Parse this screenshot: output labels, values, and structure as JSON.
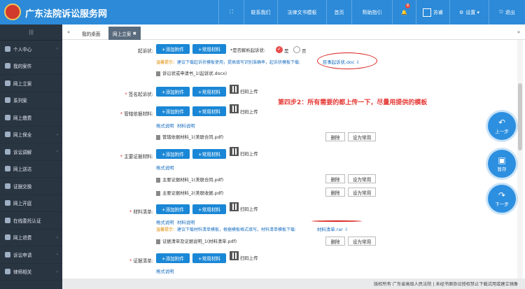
{
  "header": {
    "brand": "广东法院诉讼服务网",
    "nav": [
      {
        "icon": "fullscreen-icon",
        "label": "⛶"
      },
      {
        "label": "联系我们"
      },
      {
        "label": "法律文书模板"
      },
      {
        "label": "首页"
      },
      {
        "label": "帮助指引"
      },
      {
        "icon": "bell-icon",
        "badge": "8"
      },
      {
        "label": "苏睿"
      },
      {
        "label": "设置"
      },
      {
        "label": "退出"
      }
    ]
  },
  "sidebar": {
    "toggle": "|||",
    "items": [
      {
        "label": "个人中心",
        "arrow": "‹"
      },
      {
        "label": "我的案件"
      },
      {
        "label": "网上立案"
      },
      {
        "label": "系列案"
      },
      {
        "label": "网上缴费"
      },
      {
        "label": "网上保全",
        "arrow": "‹"
      },
      {
        "label": "诉讼调解",
        "arrow": "‹"
      },
      {
        "label": "网上送达"
      },
      {
        "label": "证据交换"
      },
      {
        "label": "网上开庭"
      },
      {
        "label": "在线委托认证"
      },
      {
        "label": "网上退费",
        "arrow": "‹"
      },
      {
        "label": "诉讼申请",
        "arrow": "‹"
      },
      {
        "label": "律师相关",
        "arrow": "‹"
      }
    ]
  },
  "tabs": {
    "prev": "«",
    "next": "»",
    "items": [
      {
        "label": "我的桌面"
      },
      {
        "label": "网上立案",
        "close": "✖"
      }
    ]
  },
  "form": {
    "add_attachment": "+添加附件",
    "common_material": "+常用材料",
    "scan_upload": "扫码上传",
    "delete": "删除",
    "set_common": "设为常用",
    "format_desc": "格式说明",
    "material_desc": "材料说明",
    "complaint": {
      "label": "起诉状:",
      "parse_question": "*是否解析起诉状:",
      "yes": "是",
      "no": "否",
      "warn_prefix": "温馨提示：",
      "warn_text": "建议下载起诉状模板使用，提高填写识别准确率，起诉状模板下载:",
      "template_link": "民事起诉状.doc",
      "file": "诉讼状或申请书_1(起诉状.docx)"
    },
    "signed_complaint": {
      "label": "签名起诉状:"
    },
    "jurisdiction": {
      "label": "管辖依据材料:",
      "file": "管辖依据材料_1(美联合同.pdf)"
    },
    "main_evidence": {
      "label": "主要证据材料:",
      "files": [
        "主要证据材料_1(美联合同.pdf)",
        "主要证据材料_2(美联收据.pdf)"
      ]
    },
    "material_list": {
      "label": "材料清单:",
      "warn_prefix": "温馨提示：",
      "warn_text": "建议下载材料清单模板，根据模板格式填写。材料清单模板下载:",
      "template_link": "材料清单.rar",
      "file": "证据清单及证据说明_1(材料清单.pdf)"
    },
    "evidence_list": {
      "label": "证据清单:"
    }
  },
  "annotation": "第四步2：所有需要的都上传一下，尽量用提供的模板",
  "float_buttons": {
    "prev": {
      "icon": "undo-icon",
      "label": "上一步"
    },
    "save": {
      "icon": "save-icon",
      "label": "暂存"
    },
    "next": {
      "icon": "redo-icon",
      "label": "下一步"
    }
  },
  "footer": "版权所有 广东省高级人民法院 | 未经书面协议授权禁止下载试用或建立镜像",
  "colors": {
    "header": "#2c8ad8",
    "sidebar": "#2a3542",
    "button": "#1a87d6",
    "annotation": "#e53935"
  }
}
